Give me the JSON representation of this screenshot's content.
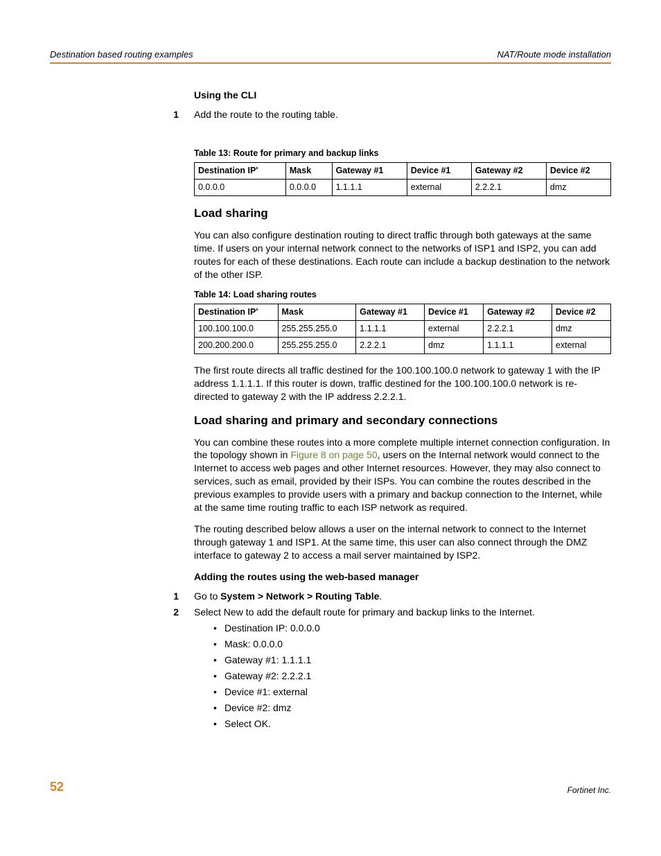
{
  "header": {
    "left": "Destination based routing examples",
    "right": "NAT/Route mode installation"
  },
  "cli": {
    "heading": "Using the CLI",
    "step1_num": "1",
    "step1_text": "Add the route to the routing table."
  },
  "table13": {
    "caption": "Table 13: Route for primary and backup links",
    "headers": [
      "Destination IP'",
      "Mask",
      "Gateway #1",
      "Device #1",
      "Gateway #2",
      "Device #2"
    ],
    "rows": [
      [
        "0.0.0.0",
        "0.0.0.0",
        "1.1.1.1",
        "external",
        "2.2.2.1",
        "dmz"
      ]
    ]
  },
  "loadsharing": {
    "title": "Load sharing",
    "para1": "You can also configure destination routing to direct traffic through both gateways at the same time. If users on your internal network connect to the networks of ISP1 and ISP2, you can add routes for each of these destinations. Each route can include a backup destination to the network of the other ISP."
  },
  "table14": {
    "caption": "Table 14: Load sharing routes",
    "headers": [
      "Destination IP'",
      "Mask",
      "Gateway #1",
      "Device #1",
      "Gateway #2",
      "Device #2"
    ],
    "rows": [
      [
        "100.100.100.0",
        "255.255.255.0",
        "1.1.1.1",
        "external",
        "2.2.2.1",
        "dmz"
      ],
      [
        "200.200.200.0",
        "255.255.255.0",
        "2.2.2.1",
        "dmz",
        "1.1.1.1",
        "external"
      ]
    ]
  },
  "after_t14": "The first route directs all traffic destined for the 100.100.100.0 network to gateway 1 with the IP address 1.1.1.1. If this router is down, traffic destined for the 100.100.100.0 network is re-directed to gateway 2 with the IP address 2.2.2.1.",
  "combined": {
    "title": "Load sharing and primary and secondary connections",
    "para1_a": "You can combine these routes into a more complete multiple internet connection configuration. In the topology shown in ",
    "link": "Figure 8 on page 50",
    "para1_b": ", users on the Internal network would connect to the Internet to access web pages and other Internet resources. However, they may also connect to services, such as email, provided by their ISPs. You can combine the routes described in the previous examples to provide users with a primary and backup connection to the Internet, while at the same time routing traffic to each ISP network as required.",
    "para2": "The routing described below allows a user on the internal network to connect to the Internet through gateway 1 and ISP1. At the same time, this user can also connect through the DMZ interface to gateway 2 to access a mail server maintained by ISP2."
  },
  "webmgr": {
    "heading": "Adding the routes using the web-based manager",
    "step1_num": "1",
    "step1_pre": "Go to ",
    "step1_path": "System > Network > Routing Table",
    "step1_post": ".",
    "step2_num": "2",
    "step2_text": "Select New to add the default route for primary and backup links to the Internet.",
    "bullets": [
      "Destination IP: 0.0.0.0",
      "Mask: 0.0.0.0",
      "Gateway #1: 1.1.1.1",
      "Gateway #2: 2.2.2.1",
      "Device #1: external",
      "Device #2: dmz",
      "Select OK."
    ]
  },
  "footer": {
    "page": "52",
    "right": "Fortinet Inc."
  }
}
